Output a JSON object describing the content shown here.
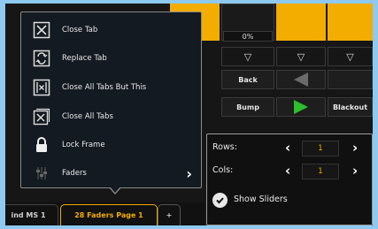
{
  "menu": {
    "items": [
      {
        "label": "Close Tab",
        "icon": "close-tab-icon"
      },
      {
        "label": "Replace Tab",
        "icon": "replace-tab-icon"
      },
      {
        "label": "Close All Tabs But This",
        "icon": "close-others-icon"
      },
      {
        "label": "Close All Tabs",
        "icon": "close-all-tabs-icon"
      },
      {
        "label": "Lock Frame",
        "icon": "lock-icon"
      },
      {
        "label": "Faders",
        "icon": "faders-icon",
        "has_submenu": true
      }
    ]
  },
  "faders": {
    "percent": "0%",
    "buttons": {
      "back": "Back",
      "bump": "Bump",
      "blackout": "Blackout"
    }
  },
  "tabs": [
    {
      "label": "ind MS 1"
    },
    {
      "label": "28 Faders Page 1"
    },
    {
      "label": "+"
    }
  ],
  "config": {
    "rows_label": "Rows:",
    "rows_value": "1",
    "cols_label": "Cols:",
    "cols_value": "1",
    "show_sliders_label": "Show Sliders",
    "show_sliders": true
  },
  "colors": {
    "accent": "#f2ad00",
    "go_green": "#2bbf2b",
    "background": "#8ec9ef"
  }
}
